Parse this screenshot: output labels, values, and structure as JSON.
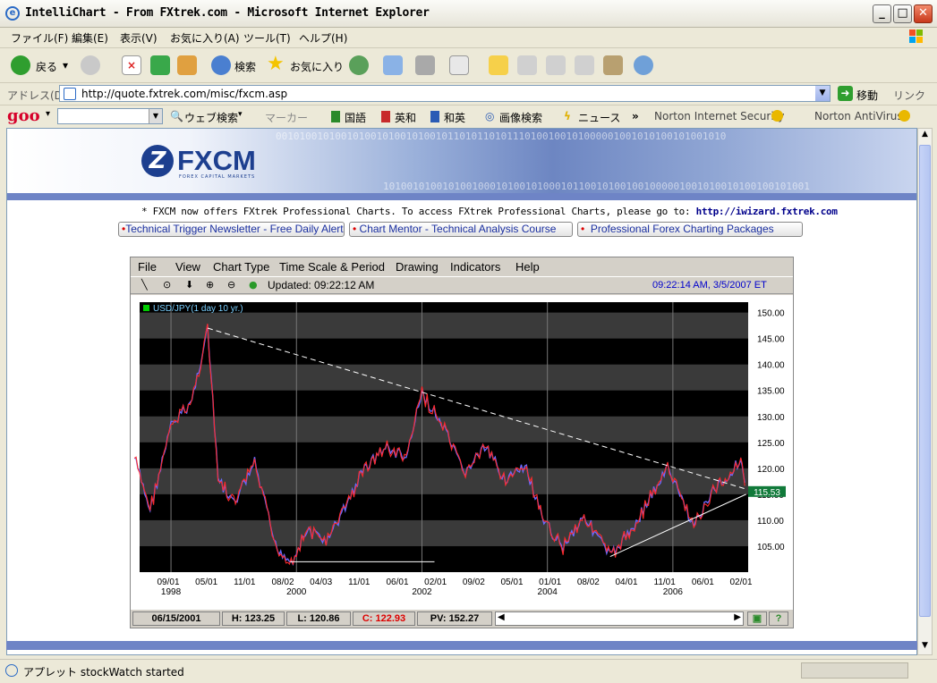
{
  "window": {
    "title": "IntelliChart - From FXtrek.com - Microsoft Internet Explorer",
    "minimize": "_",
    "maximize": "□",
    "close": "✕"
  },
  "menu": [
    "ファイル(F)",
    "編集(E)",
    "表示(V)",
    "お気に入り(A)",
    "ツール(T)",
    "ヘルプ(H)"
  ],
  "toolbar": {
    "back": "戻る",
    "search": "検索",
    "favorites": "お気に入り"
  },
  "address": {
    "label": "アドレス(D)",
    "url": "http://quote.fxtrek.com/misc/fxcm.asp",
    "go": "移動",
    "links": "リンク"
  },
  "goobar": {
    "logo": "goo",
    "web_search": "ウェブ検索",
    "marker": "マーカー",
    "kokugo": "国語",
    "eiwa": "英和",
    "waei": "和英",
    "image_search": "画像検索",
    "news": "ニュース",
    "chev": "»",
    "norton_is": "Norton Internet Security",
    "norton_av": "Norton AntiVirus"
  },
  "banner": {
    "logo_mark": "Z",
    "logo_word": "FXCM",
    "logo_sub": "FOREX CAPITAL MARKETS",
    "binary1": "0010100101001010010100101001011010110101110100100101000001001010100101001010",
    "binary2": "101001010010100100010100101000101100101001001000001001010010100100101001"
  },
  "notice": {
    "text": "* FXCM now offers FXtrek Professional Charts. To access FXtrek Professional Charts, please go to:",
    "link": "http://iwizard.fxtrek.com"
  },
  "links": [
    "Technical Trigger Newsletter - Free Daily Alerts",
    "Chart Mentor - Technical Analysis Course",
    "Professional Forex Charting Packages"
  ],
  "applet": {
    "menu": [
      "File",
      "View",
      "Chart Type",
      "Time Scale & Period",
      "Drawing",
      "Indicators",
      "Help"
    ],
    "updated": "Updated: 09:22:12 AM",
    "timestamp": "09:22:14 AM, 3/5/2007 ET",
    "status": {
      "date": "06/15/2001",
      "high": "H: 123.25",
      "low": "L: 120.86",
      "close": "C: 122.93",
      "pv": "PV: 152.27"
    }
  },
  "chart_data": {
    "type": "line",
    "legend": "USD/JPY(1 day  10 yr.)",
    "last_price": "115.53",
    "ylim": [
      100,
      152
    ],
    "y_ticks": [
      "150.00",
      "145.00",
      "140.00",
      "135.00",
      "130.00",
      "125.00",
      "120.00",
      "115.00",
      "110.00",
      "105.00"
    ],
    "x_ticks": [
      "09/01",
      "05/01",
      "11/01",
      "08/02",
      "04/03",
      "11/01",
      "06/01",
      "02/01",
      "09/02",
      "05/01",
      "01/01",
      "08/02",
      "04/01",
      "11/01",
      "06/01",
      "02/01"
    ],
    "year_ticks": [
      "1998",
      "2000",
      "2002",
      "2004",
      "2006"
    ],
    "series": [
      {
        "x": [
          "1997-06",
          "1997-09",
          "1998-01",
          "1998-05",
          "1998-08",
          "1998-10",
          "1999-01",
          "1999-05",
          "1999-09",
          "1999-12",
          "2000-03",
          "2000-07",
          "2000-11",
          "2001-02",
          "2001-06",
          "2001-10",
          "2002-01",
          "2002-05",
          "2002-09",
          "2003-01",
          "2003-05",
          "2003-09",
          "2003-12",
          "2004-04",
          "2004-08",
          "2005-01",
          "2005-05",
          "2005-09",
          "2005-12",
          "2006-05",
          "2006-09",
          "2006-12",
          "2007-02",
          "2007-03"
        ],
        "values": [
          122,
          112,
          128,
          133,
          147,
          118,
          113,
          121,
          105,
          102,
          108,
          106,
          114,
          120,
          124,
          122,
          134.5,
          128,
          119,
          124,
          118,
          120,
          110,
          105,
          111,
          103,
          108,
          115,
          120,
          109,
          116,
          119,
          122,
          115.53
        ]
      }
    ],
    "trendlines": [
      {
        "from": [
          "1998-08",
          147
        ],
        "to": [
          "2007-03",
          116
        ]
      },
      {
        "from": [
          "2005-01",
          103
        ],
        "to": [
          "2007-03",
          115
        ]
      }
    ]
  },
  "statusbar": {
    "text": "アプレット stockWatch started"
  }
}
